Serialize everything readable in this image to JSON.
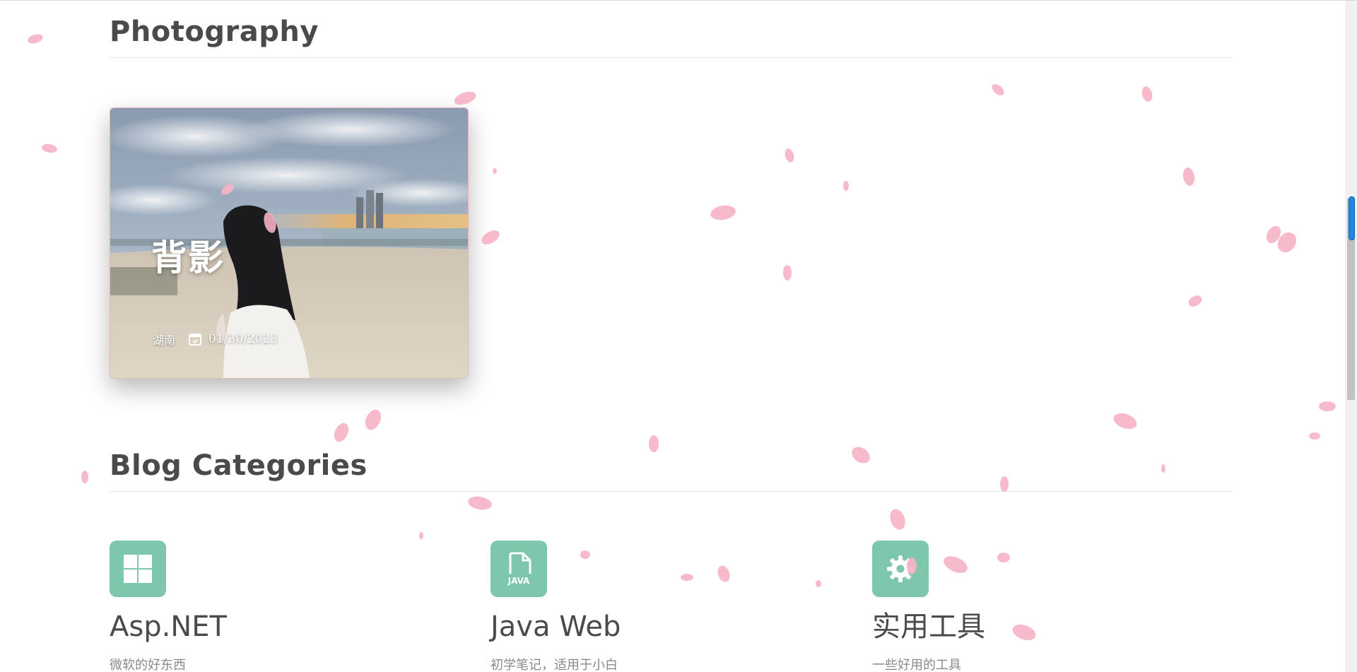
{
  "photography": {
    "section_title": "Photography",
    "card": {
      "title": "背影",
      "location": "湖南",
      "date": "01/30/2023"
    }
  },
  "categories": {
    "section_title": "Blog Categories",
    "items": [
      {
        "name": "Asp.NET",
        "desc": "微软的好东西",
        "icon": "windows-icon"
      },
      {
        "name": "Java Web",
        "desc": "初学笔记，适用于小白",
        "icon": "java-file-icon"
      },
      {
        "name": "实用工具",
        "desc": "一些好用的工具",
        "icon": "gear-icon"
      }
    ],
    "java_icon_text": "JAVA"
  },
  "colors": {
    "accent": "#7ec7ad",
    "petal": "#f6b3c6",
    "title_text": "#4a4a4a",
    "desc_text": "#8a8a8a"
  }
}
